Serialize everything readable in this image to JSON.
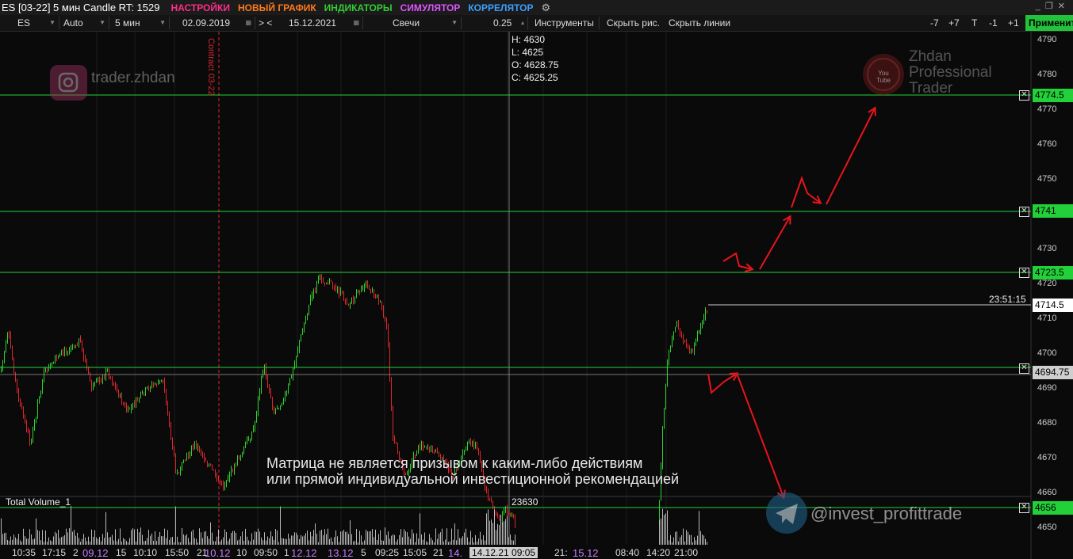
{
  "titlebar": {
    "title": "ES [03-22] 5 мин Candle RT: 1529",
    "menus": [
      {
        "label": "НАСТРОЙКИ",
        "color": "#ff2e8a"
      },
      {
        "label": "НОВЫЙ ГРАФИК",
        "color": "#ff7a1a"
      },
      {
        "label": "ИНДИКАТОРЫ",
        "color": "#32cd32"
      },
      {
        "label": "СИМУЛЯТОР",
        "color": "#e056fd"
      },
      {
        "label": "КОРРЕЛЯТОР",
        "color": "#3aa0ff"
      }
    ],
    "gear_icon": "gears-icon"
  },
  "toolbar": {
    "symbol": "ES",
    "scale_mode": "Auto",
    "timeframe": "5 мин",
    "date_from": "02.09.2019",
    "nav": "> <",
    "date_to": "15.12.2021",
    "chart_type": "Свечи",
    "tick_size": "0.25",
    "instruments": "Инструменты",
    "hide_drawings": "Скрыть рис.",
    "hide_lines": "Скрыть линии",
    "btn_minus7": "-7",
    "btn_plus7": "+7",
    "btn_t": "T",
    "btn_minus1": "-1",
    "btn_plus1": "+1",
    "apply": "Применить"
  },
  "ohlc": {
    "h": "H: 4630",
    "l": "L: 4625",
    "o": "O: 4628.75",
    "c": "C: 4625.25"
  },
  "contract_marker": "Contract 03-22",
  "watermarks": {
    "instagram": "trader.zhdan",
    "youtube_badge": "You Tube",
    "youtube_line1": "Zhdan",
    "youtube_line2": "Professional",
    "youtube_line3": "Trader",
    "telegram": "@invest_profittrade"
  },
  "disclaimer": {
    "line1": "Матрица не является призывом к каким-либо действиям",
    "line2": "или прямой индивидуальной инвестиционной рекомендацией"
  },
  "price_axis": {
    "ticks": [
      "4790",
      "4780",
      "4770",
      "4760",
      "4750",
      "4740",
      "4730",
      "4720",
      "4710",
      "4700",
      "4690",
      "4680",
      "4670",
      "4660",
      "4650"
    ],
    "levels": [
      {
        "label": "4774.5"
      },
      {
        "label": "4741"
      },
      {
        "label": "4723.5"
      },
      {
        "label": "4694.75"
      },
      {
        "label": "4656"
      }
    ],
    "current_price": "4714.5",
    "timer": "23:51:15"
  },
  "volume": {
    "label": "Total Volume_1",
    "value": "23630"
  },
  "time_axis": [
    {
      "label": "10:35",
      "day": false
    },
    {
      "label": "17:15",
      "day": false
    },
    {
      "label": "2",
      "day": false
    },
    {
      "label": "09.12",
      "day": true
    },
    {
      "label": "15",
      "day": false
    },
    {
      "label": "10:10",
      "day": false
    },
    {
      "label": "15:50",
      "day": false
    },
    {
      "label": "21",
      "day": false
    },
    {
      "label": "10.12",
      "day": true
    },
    {
      "label": "10",
      "day": false
    },
    {
      "label": "09:50",
      "day": false
    },
    {
      "label": "1",
      "day": false
    },
    {
      "label": "12.12",
      "day": true
    },
    {
      "label": "13.12",
      "day": true
    },
    {
      "label": "5",
      "day": false
    },
    {
      "label": "09:25",
      "day": false
    },
    {
      "label": "15:05",
      "day": false
    },
    {
      "label": "21",
      "day": false
    },
    {
      "label": "14.",
      "day": true
    },
    {
      "label": "14.12.21 09:05",
      "day": false
    },
    {
      "label": "21:",
      "day": false
    },
    {
      "label": "15.12",
      "day": true
    },
    {
      "label": "08:40",
      "day": false
    },
    {
      "label": "14:20",
      "day": false
    },
    {
      "label": "21:00",
      "day": false
    }
  ],
  "colors": {
    "level_line": "#22d13a",
    "candle_up": "#2fd12f",
    "candle_down": "#e0262e",
    "arrow": "#e8141b",
    "contract_line": "#d7262e"
  }
}
